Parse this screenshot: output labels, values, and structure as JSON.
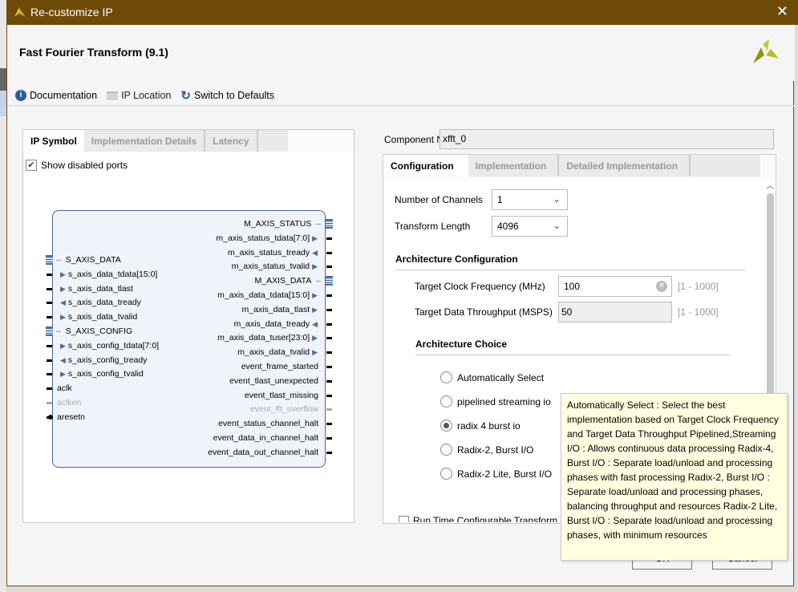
{
  "window": {
    "title": "Re-customize IP",
    "close": "✕"
  },
  "ip": {
    "name": "Fast Fourier Transform (9.1)"
  },
  "toolbar": {
    "documentation": "Documentation",
    "ip_location": "IP Location",
    "switch_defaults": "Switch to Defaults"
  },
  "left": {
    "tabs": [
      "IP Symbol",
      "Implementation Details",
      "Latency"
    ],
    "show_disabled": "Show disabled ports",
    "left_ports": [
      {
        "label": "S_AXIS_DATA",
        "kind": "bus"
      },
      {
        "label": "s_axis_data_tdata[15:0]",
        "dir": "in"
      },
      {
        "label": "s_axis_data_tlast",
        "dir": "in"
      },
      {
        "label": "s_axis_data_tready",
        "dir": "out"
      },
      {
        "label": "s_axis_data_tvalid",
        "dir": "in"
      },
      {
        "label": "S_AXIS_CONFIG",
        "kind": "bus"
      },
      {
        "label": "s_axis_config_tdata[7:0]",
        "dir": "in"
      },
      {
        "label": "s_axis_config_tready",
        "dir": "out"
      },
      {
        "label": "s_axis_config_tvalid",
        "dir": "in"
      },
      {
        "label": "aclk",
        "kind": "plain"
      },
      {
        "label": "aclken",
        "kind": "disabled"
      },
      {
        "label": "aresetn",
        "kind": "neg"
      }
    ],
    "right_ports": [
      {
        "label": "M_AXIS_STATUS",
        "kind": "bus"
      },
      {
        "label": "m_axis_status_tdata[7:0]",
        "dir": "out"
      },
      {
        "label": "m_axis_status_tready",
        "dir": "in"
      },
      {
        "label": "m_axis_status_tvalid",
        "dir": "out"
      },
      {
        "label": "M_AXIS_DATA",
        "kind": "bus"
      },
      {
        "label": "m_axis_data_tdata[15:0]",
        "dir": "out"
      },
      {
        "label": "m_axis_data_tlast",
        "dir": "out"
      },
      {
        "label": "m_axis_data_tready",
        "dir": "in"
      },
      {
        "label": "m_axis_data_tuser[23:0]",
        "dir": "out"
      },
      {
        "label": "m_axis_data_tvalid",
        "dir": "out"
      },
      {
        "label": "event_frame_started",
        "kind": "plain"
      },
      {
        "label": "event_tlast_unexpected",
        "kind": "plain"
      },
      {
        "label": "event_tlast_missing",
        "kind": "plain"
      },
      {
        "label": "event_fft_overflow",
        "kind": "disabled"
      },
      {
        "label": "event_status_channel_halt",
        "kind": "plain"
      },
      {
        "label": "event_data_in_channel_halt",
        "kind": "plain"
      },
      {
        "label": "event_data_out_channel_halt",
        "kind": "plain"
      }
    ]
  },
  "right": {
    "component_label": "Component Name",
    "component_value": "xfft_0",
    "tabs": [
      "Configuration",
      "Implementation",
      "Detailed Implementation"
    ],
    "channels_label": "Number of Channels",
    "channels_value": "1",
    "length_label": "Transform Length",
    "length_value": "4096",
    "arch_config": "Architecture Configuration",
    "clock_label": "Target Clock Frequency (MHz)",
    "clock_value": "100",
    "clock_range": "[1 - 1000]",
    "throughput_label": "Target Data Throughput (MSPS)",
    "throughput_value": "50",
    "throughput_range": "[1 - 1000]",
    "arch_choice": "Architecture Choice",
    "options": [
      "Automatically Select",
      "pipelined streaming io",
      "radix 4 burst io",
      "Radix-2, Burst I/O",
      "Radix-2 Lite, Burst I/O"
    ],
    "selected": "radix 4 burst io",
    "runtime_label": "Run Time Configurable Transform"
  },
  "buttons": {
    "ok": "OK",
    "cancel": "Cancel"
  },
  "tooltip": "Automatically Select : Select the best implementation based on Target Clock Frequency and Target Data Throughput Pipelined,Streaming I/O : Allows continuous data processing Radix-4, Burst I/O : Separate load/unload and processing phases with fast processing Radix-2, Burst I/O : Separate load/unload and processing phases, balancing throughput and resources Radix-2 Lite, Burst I/O : Separate load/unload and processing phases, with minimum resources",
  "colors": {
    "titlebar": "#6f4b0a",
    "port_accent": "#4a6aa8",
    "tooltip_bg": "#ffffe1"
  }
}
